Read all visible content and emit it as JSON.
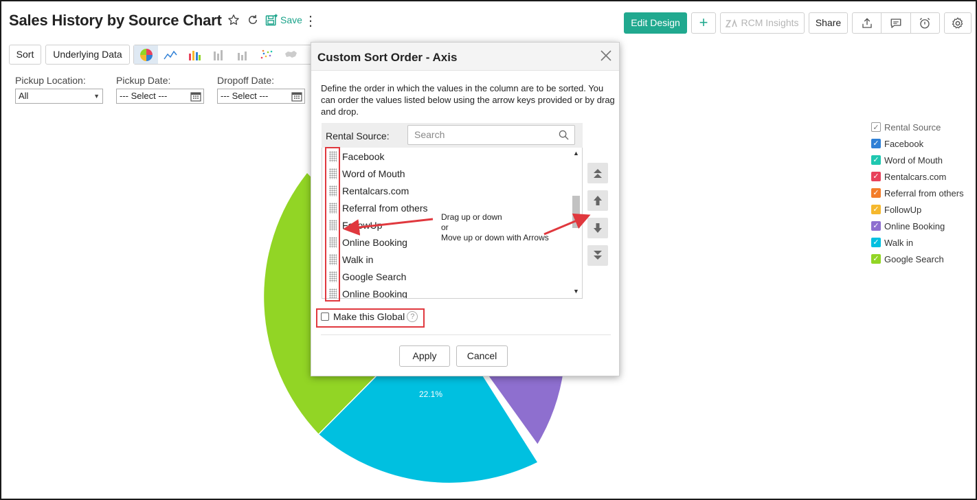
{
  "header": {
    "title": "Sales History by Source Chart",
    "save_label": "Save",
    "edit_design_label": "Edit Design",
    "rcm_label": "RCM Insights",
    "share_label": "Share"
  },
  "toolbar": {
    "sort_label": "Sort",
    "underlying_label": "Underlying Data",
    "chart_types": [
      "pie-icon",
      "line-icon",
      "bar-icon",
      "stacked-bar-icon",
      "column-icon",
      "scatter-icon",
      "map-icon"
    ]
  },
  "filters": [
    {
      "label": "Pickup Location:",
      "value": "All"
    },
    {
      "label": "Pickup Date:",
      "value": "--- Select ---"
    },
    {
      "label": "Dropoff Date:",
      "value": "--- Select ---"
    }
  ],
  "chart_data": {
    "type": "pie",
    "visible_label": "22.1%",
    "slices": [
      {
        "name": "Walk in",
        "color": "#00c0e0",
        "value": 22.1
      },
      {
        "name": "Online Booking",
        "color": "#8e6fcf"
      },
      {
        "name": "Google Search",
        "color": "#92d525"
      }
    ],
    "legend": {
      "title": "Rental Source",
      "placement": "right",
      "items": [
        {
          "name": "Facebook",
          "color": "#2f80d6"
        },
        {
          "name": "Word of Mouth",
          "color": "#1fc7b0"
        },
        {
          "name": "Rentalcars.com",
          "color": "#e8425c"
        },
        {
          "name": "Referral from others",
          "color": "#f37d2b"
        },
        {
          "name": "FollowUp",
          "color": "#f5b82e"
        },
        {
          "name": "Online Booking",
          "color": "#8e6fcf"
        },
        {
          "name": "Walk in",
          "color": "#00c0e0"
        },
        {
          "name": "Google Search",
          "color": "#92d525"
        }
      ]
    }
  },
  "modal": {
    "title": "Custom Sort Order - Axis",
    "description": "Define the order in which the values in the column are to be sorted. You can order the values listed below using the arrow keys provided or by drag and drop.",
    "column_label": "Rental Source:",
    "search_placeholder": "Search",
    "items": [
      "Facebook",
      "Word of Mouth",
      "Rentalcars.com",
      "Referral from others",
      "FollowUp",
      "Online Booking",
      "Walk in",
      "Google Search",
      "Online Booking"
    ],
    "annotation_line1": "Drag up or down",
    "annotation_line2": "or",
    "annotation_line3": "Move up or down with Arrows",
    "global_label": "Make this Global",
    "help_label": "?",
    "apply_label": "Apply",
    "cancel_label": "Cancel"
  },
  "colors": {
    "accent": "#21a98f",
    "annotation_red": "#e0383e"
  }
}
